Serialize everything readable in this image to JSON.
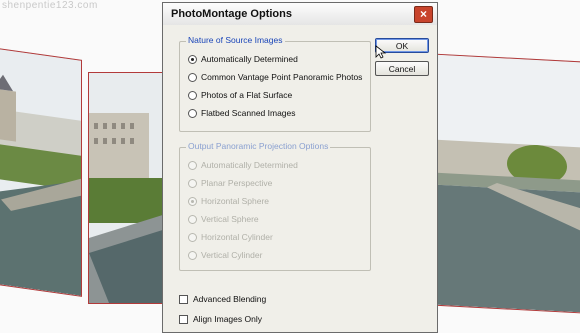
{
  "watermark": "shenpentie123.com",
  "dialog": {
    "title": "PhotoMontage Options",
    "close_glyph": "×",
    "buttons": {
      "ok": "OK",
      "cancel": "Cancel"
    },
    "source_group": {
      "legend": "Nature of Source Images",
      "options": [
        {
          "label": "Automatically Determined",
          "selected": true
        },
        {
          "label": "Common Vantage Point Panoramic Photos",
          "selected": false
        },
        {
          "label": "Photos of a Flat Surface",
          "selected": false
        },
        {
          "label": "Flatbed Scanned Images",
          "selected": false
        }
      ]
    },
    "projection_group": {
      "legend": "Output Panoramic Projection Options",
      "disabled": true,
      "options": [
        {
          "label": "Automatically Determined",
          "selected": false
        },
        {
          "label": "Planar Perspective",
          "selected": false
        },
        {
          "label": "Horizontal Sphere",
          "selected": true
        },
        {
          "label": "Vertical Sphere",
          "selected": false
        },
        {
          "label": "Horizontal Cylinder",
          "selected": false
        },
        {
          "label": "Vertical Cylinder",
          "selected": false
        }
      ]
    },
    "checkboxes": [
      {
        "label": "Advanced Blending",
        "checked": false
      },
      {
        "label": "Align Images Only",
        "checked": false
      }
    ]
  },
  "colors": {
    "group_legend": "#1a45b8",
    "close_button": "#c8442c",
    "photo_border": "#b23a3a"
  }
}
